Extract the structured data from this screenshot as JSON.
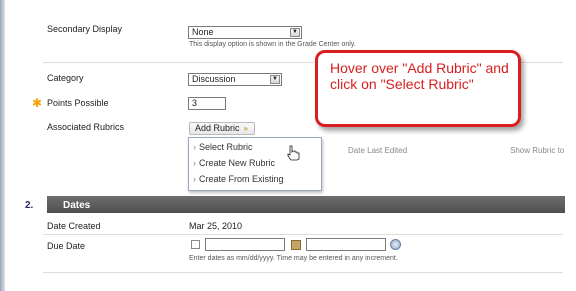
{
  "secondary_display": {
    "label": "Secondary Display",
    "value": "None",
    "hint": "This display option is shown in the Grade Center only."
  },
  "category": {
    "label": "Category",
    "value": "Discussion"
  },
  "points_possible": {
    "label": "Points Possible",
    "value": "3"
  },
  "associated_rubrics": {
    "label": "Associated Rubrics",
    "add_button": "Add Rubric"
  },
  "rubric_menu": {
    "items": [
      "Select Rubric",
      "Create New Rubric",
      "Create From Existing"
    ]
  },
  "rubric_table": {
    "date_last_edited": "Date Last Edited",
    "show_rubric": "Show Rubric to"
  },
  "callout": {
    "text": "Hover over \"Add Rubric\" and click on \"Select Rubric\""
  },
  "dates_section": {
    "number": "2.",
    "title": "Dates"
  },
  "date_created": {
    "label": "Date Created",
    "value": "Mar 25, 2010"
  },
  "due_date": {
    "label": "Due Date",
    "date_value": "",
    "time_value": "",
    "hint": "Enter dates as mm/dd/yyyy. Time may be entered in any increment."
  },
  "colors": {
    "accent_red": "#d81e1e",
    "section_bar": "#5a5a5a",
    "required_star": "#f2a100"
  },
  "icons": [
    "asterisk-required-icon",
    "dropdown-arrow-icon",
    "chevron-down-icon",
    "hand-cursor-icon",
    "calendar-icon",
    "clock-icon"
  ]
}
